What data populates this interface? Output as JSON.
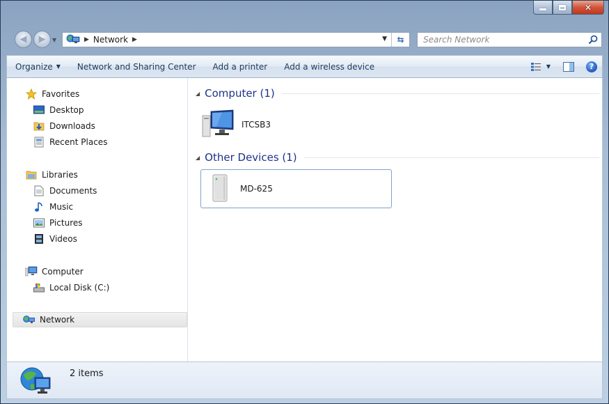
{
  "window": {
    "minimize_icon": "minimize-icon",
    "maximize_icon": "maximize-icon",
    "close_icon": "close-icon"
  },
  "address": {
    "breadcrumb": [
      "Network"
    ],
    "search_placeholder": "Search Network"
  },
  "toolbar": {
    "organize": "Organize",
    "network_center": "Network and Sharing Center",
    "add_printer": "Add a printer",
    "add_wireless": "Add a wireless device"
  },
  "sidebar": {
    "favorites": {
      "label": "Favorites",
      "items": [
        "Desktop",
        "Downloads",
        "Recent Places"
      ]
    },
    "libraries": {
      "label": "Libraries",
      "items": [
        "Documents",
        "Music",
        "Pictures",
        "Videos"
      ]
    },
    "computer": {
      "label": "Computer",
      "items": [
        "Local Disk (C:)"
      ]
    },
    "network": {
      "label": "Network",
      "selected": true
    }
  },
  "main": {
    "groups": [
      {
        "title": "Computer (1)",
        "items": [
          {
            "name": "ITCSB3",
            "icon": "computer-icon"
          }
        ]
      },
      {
        "title": "Other Devices (1)",
        "items": [
          {
            "name": "MD-625",
            "icon": "device-icon",
            "selected": true
          }
        ]
      }
    ]
  },
  "status": {
    "count_text": "2 items"
  },
  "colors": {
    "group_title": "#1e3287",
    "toolbar_text": "#1e395b",
    "selection_border": "#7da2ce"
  }
}
